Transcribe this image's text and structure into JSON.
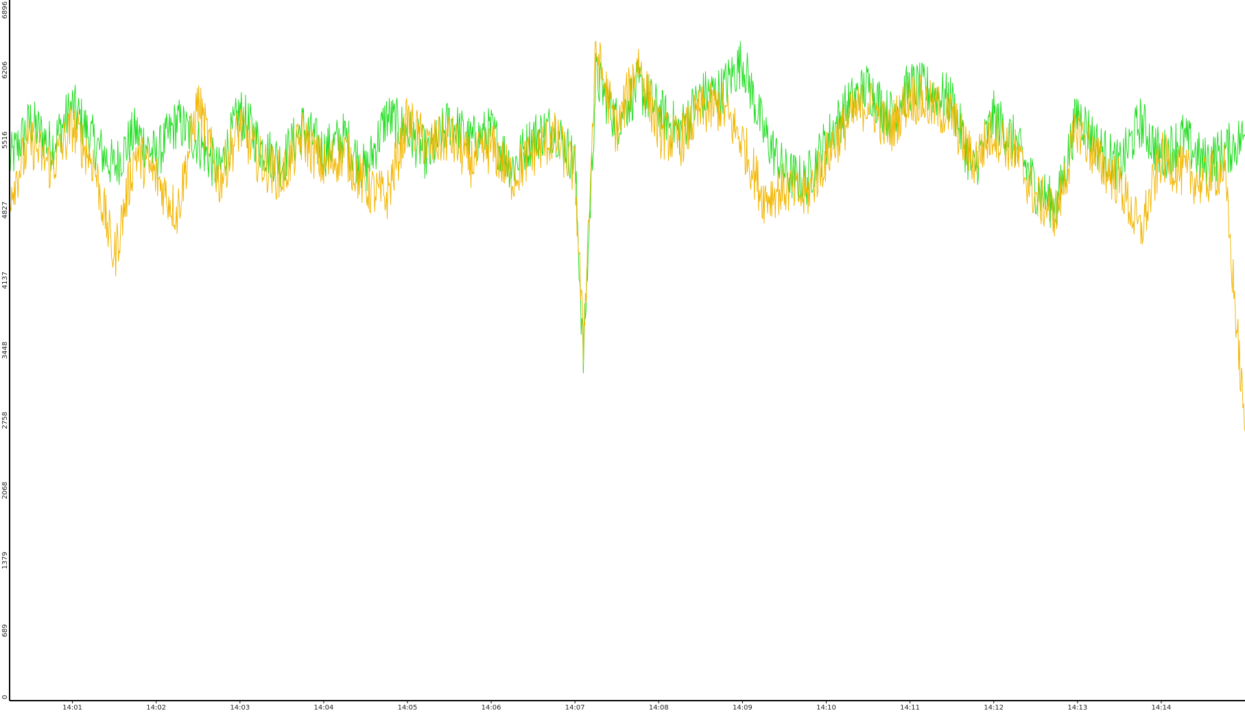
{
  "chart_data": {
    "type": "line",
    "title": "",
    "xlabel": "",
    "ylabel": "",
    "ylim": [
      0,
      6896
    ],
    "xlim": [
      "14:00:15",
      "14:15:00"
    ],
    "grid": false,
    "legend": "none",
    "y_ticks": [
      "0",
      "689",
      "1379",
      "2068",
      "2758",
      "3448",
      "4137",
      "4827",
      "5516",
      "6206",
      "6896"
    ],
    "x_ticks": [
      "14:01",
      "14:02",
      "14:03",
      "14:04",
      "14:05",
      "14:06",
      "14:07",
      "14:08",
      "14:09",
      "14:10",
      "14:11",
      "14:12",
      "14:13",
      "14:14"
    ],
    "series": [
      {
        "color": "#22dd22",
        "x": [
          "14:00:15",
          "14:00:30",
          "14:00:45",
          "14:01:00",
          "14:01:15",
          "14:01:30",
          "14:01:45",
          "14:02:00",
          "14:02:15",
          "14:02:30",
          "14:02:45",
          "14:03:00",
          "14:03:15",
          "14:03:30",
          "14:03:45",
          "14:04:00",
          "14:04:15",
          "14:04:30",
          "14:04:45",
          "14:05:00",
          "14:05:15",
          "14:05:30",
          "14:05:45",
          "14:06:00",
          "14:06:15",
          "14:06:30",
          "14:06:45",
          "14:07:00",
          "14:07:06",
          "14:07:15",
          "14:07:30",
          "14:07:45",
          "14:08:00",
          "14:08:15",
          "14:08:30",
          "14:08:45",
          "14:09:00",
          "14:09:15",
          "14:09:30",
          "14:09:45",
          "14:10:00",
          "14:10:15",
          "14:10:30",
          "14:10:45",
          "14:11:00",
          "14:11:15",
          "14:11:30",
          "14:11:45",
          "14:12:00",
          "14:12:15",
          "14:12:30",
          "14:12:45",
          "14:13:00",
          "14:13:15",
          "14:13:30",
          "14:13:45",
          "14:14:00",
          "14:14:15",
          "14:14:30",
          "14:14:45",
          "14:15:00"
        ],
        "y": [
          5300,
          5700,
          5450,
          5850,
          5500,
          5250,
          5600,
          5350,
          5700,
          5500,
          5200,
          5800,
          5450,
          5300,
          5650,
          5400,
          5550,
          5200,
          5750,
          5600,
          5350,
          5700,
          5500,
          5600,
          5250,
          5550,
          5650,
          5300,
          3350,
          6150,
          5700,
          6050,
          5800,
          5600,
          5950,
          6000,
          6300,
          5600,
          5200,
          5100,
          5500,
          5850,
          6050,
          5750,
          6050,
          6000,
          5900,
          5200,
          5750,
          5500,
          5050,
          4850,
          5800,
          5450,
          5250,
          5700,
          5350,
          5550,
          5300,
          5400,
          5550
        ]
      },
      {
        "color": "#f2b600",
        "x": [
          "14:00:15",
          "14:00:30",
          "14:00:45",
          "14:01:00",
          "14:01:15",
          "14:01:30",
          "14:01:45",
          "14:02:00",
          "14:02:15",
          "14:02:30",
          "14:02:45",
          "14:03:00",
          "14:03:15",
          "14:03:30",
          "14:03:45",
          "14:04:00",
          "14:04:15",
          "14:04:30",
          "14:04:45",
          "14:05:00",
          "14:05:15",
          "14:05:30",
          "14:05:45",
          "14:06:00",
          "14:06:15",
          "14:06:30",
          "14:06:45",
          "14:07:00",
          "14:07:06",
          "14:07:15",
          "14:07:30",
          "14:07:45",
          "14:08:00",
          "14:08:15",
          "14:08:30",
          "14:08:45",
          "14:09:00",
          "14:09:15",
          "14:09:30",
          "14:09:45",
          "14:10:00",
          "14:10:15",
          "14:10:30",
          "14:10:45",
          "14:11:00",
          "14:11:15",
          "14:11:30",
          "14:11:45",
          "14:12:00",
          "14:12:15",
          "14:12:30",
          "14:12:45",
          "14:13:00",
          "14:13:15",
          "14:13:30",
          "14:13:45",
          "14:14:00",
          "14:14:15",
          "14:14:30",
          "14:14:45",
          "14:15:00"
        ],
        "y": [
          5000,
          5500,
          5250,
          5650,
          5300,
          4350,
          5400,
          5150,
          4800,
          5900,
          5100,
          5650,
          5300,
          5150,
          5550,
          5250,
          5400,
          5050,
          4950,
          5700,
          5450,
          5550,
          5300,
          5450,
          5150,
          5400,
          5550,
          5200,
          3500,
          6400,
          5600,
          6300,
          5600,
          5500,
          5800,
          5850,
          5500,
          4950,
          5050,
          4950,
          5350,
          5700,
          5900,
          5600,
          5950,
          5850,
          5750,
          5300,
          5600,
          5400,
          4950,
          4800,
          5650,
          5300,
          5100,
          4600,
          5350,
          5200,
          5100,
          5250,
          2650
        ]
      }
    ]
  }
}
